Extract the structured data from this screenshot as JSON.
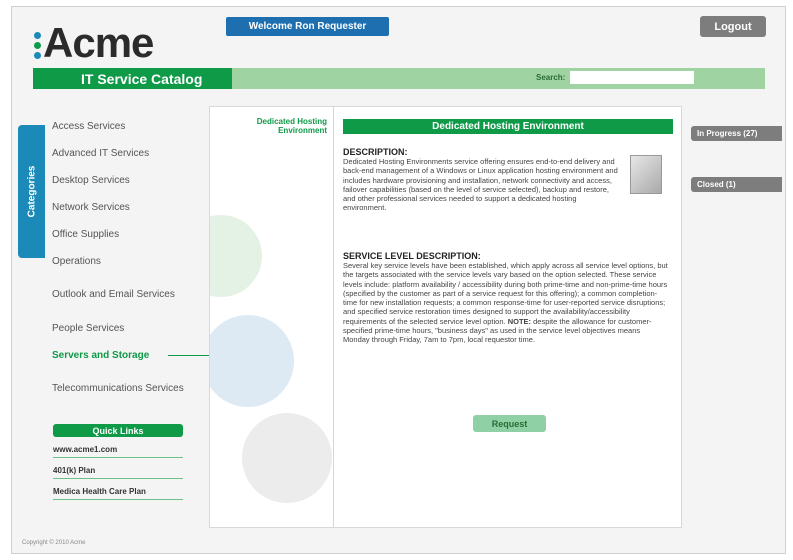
{
  "header": {
    "logo_text": "Acme",
    "logo_dot_colors": [
      "#1b8ab8",
      "#0f9a48",
      "#1b8ab8"
    ],
    "welcome_text": "Welcome Ron Requester",
    "logout_label": "Logout",
    "catalog_title": "IT Service Catalog",
    "search_label": "Search:",
    "search_value": ""
  },
  "sidebar": {
    "tab_label": "Categories",
    "items": [
      {
        "label": "Access Services"
      },
      {
        "label": "Advanced IT Services"
      },
      {
        "label": "Desktop Services"
      },
      {
        "label": "Network Services"
      },
      {
        "label": "Office Supplies"
      },
      {
        "label": "Operations"
      },
      {
        "label": "Outlook and Email Services"
      },
      {
        "label": "People Services"
      },
      {
        "label": "Servers and Storage",
        "active": true
      },
      {
        "label": "Telecommunications Services"
      }
    ]
  },
  "quick_links": {
    "title": "Quick Links",
    "items": [
      "www.acme1.com",
      "401(k) Plan",
      "Medica Health Care Plan"
    ]
  },
  "service_list": {
    "items": [
      "Dedicated Hosting Environment"
    ]
  },
  "detail": {
    "header": "Dedicated Hosting Environment",
    "description_title": "DESCRIPTION:",
    "description_text": "Dedicated Hosting Environments service offering ensures end-to-end delivery and back-end management of a Windows or Linux application hosting environment and includes hardware provisioning and installation, network connectivity and access, failover capabilities (based on the level of service selected), backup and restore, and other professional services needed to support a dedicated hosting environment.",
    "sla_title": "SERVICE LEVEL DESCRIPTION:",
    "sla_text": "Several key service levels have been established, which apply across all service level options, but the targets associated with the service levels vary based on the option selected. These service levels include: platform availability / accessibility during both prime-time and non-prime-time hours (specified by the customer as part of a service request for this offering); a common completion-time for new installation requests; a common response-time for user-reported service disruptions; and specified service restoration times designed to support the availability/accessibility requirements of the selected service level option.",
    "note_label": "NOTE:",
    "note_text": " despite the allowance for customer-specified prime-time hours, \"business days\" as used in the service level objectives means Monday through Friday, 7am to 7pm, local requestor time.",
    "request_label": "Request",
    "image_icon": "server-icon"
  },
  "status_panel": {
    "in_progress": "In Progress (27)",
    "closed": "Closed (1)"
  },
  "footer": {
    "copyright": "Copyright © 2010 Acme"
  },
  "colors": {
    "brand_green": "#0f9a48",
    "light_green": "#9fd4a2",
    "brand_blue": "#1d6fb0",
    "gray": "#7d7d7d"
  }
}
